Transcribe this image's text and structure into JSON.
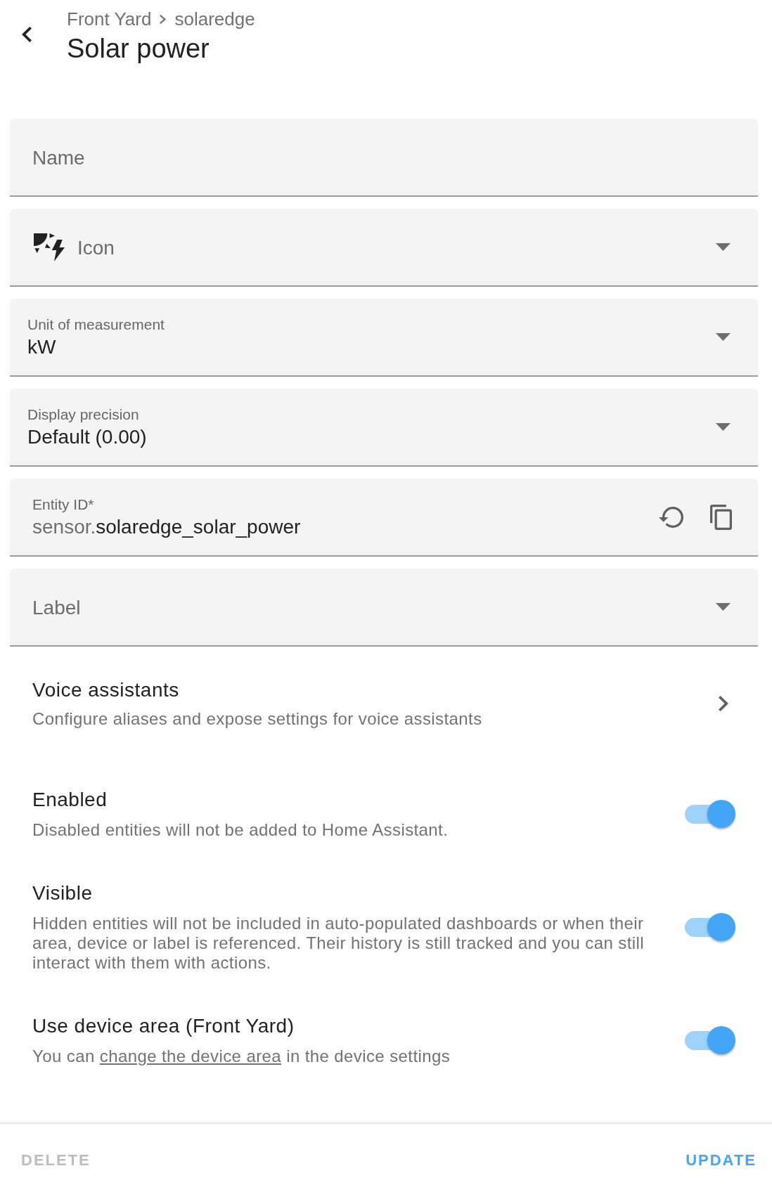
{
  "header": {
    "breadcrumb": [
      "Front Yard",
      "solaredge"
    ],
    "title": "Solar power"
  },
  "fields": [
    {
      "kind": "text",
      "label": "Name"
    },
    {
      "kind": "icon_picker",
      "label": "Icon"
    },
    {
      "kind": "select",
      "label": "Unit of measurement",
      "value": "kW"
    },
    {
      "kind": "select",
      "label": "Display precision",
      "value": "Default (0.00)"
    },
    {
      "kind": "entity_id",
      "label": "Entity ID*",
      "prefix": "sensor.",
      "value": "solaredge_solar_power"
    },
    {
      "kind": "select",
      "label": "Label"
    }
  ],
  "voice_assistants": {
    "title": "Voice assistants",
    "description": "Configure aliases and expose settings for voice assistants"
  },
  "toggles": [
    {
      "title": "Enabled",
      "description": "Disabled entities will not be added to Home Assistant.",
      "on": true
    },
    {
      "title": "Visible",
      "description": "Hidden entities will not be included in auto-populated dashboards or when their area, device or label is referenced. Their history is still tracked and you can still interact with them with actions.",
      "on": true
    },
    {
      "title": "Use device area (Front Yard)",
      "description": "You can",
      "link": "change the device area",
      "description_end": "in the device settings",
      "on": true
    }
  ],
  "buttons": [
    {
      "label": "DELETE",
      "disabled": true
    },
    {
      "label": "UPDATE",
      "disabled": false
    }
  ]
}
